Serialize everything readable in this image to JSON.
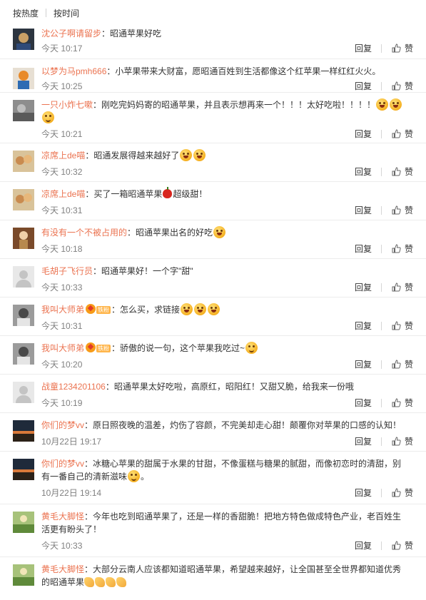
{
  "sort": {
    "hot_label": "按热度",
    "time_label": "按时间"
  },
  "actions": {
    "reply": "回复",
    "like": "赞"
  },
  "colors": {
    "username": "#eb7350",
    "meta": "#808080",
    "divider": "#ececec"
  },
  "comments": [
    {
      "user": "沈公子啊请留步",
      "text": "昭通苹果好吃",
      "time": "今天 10:17",
      "avatar": "dark-figure"
    },
    {
      "user": "以梦为马pmh666",
      "text": "小苹果带来大财富，愿昭通百姓到生活都像这个红苹果一样红红火火。",
      "time": "今天 10:25",
      "avatar": "orange-figure"
    },
    {
      "user": "一只小炸七嗽",
      "text": "刚吃完妈妈寄的昭通苹果，并且表示想再来一个！！！太好吃啦！！！！",
      "time": "今天 10:21",
      "avatar": "gray-photo"
    },
    {
      "user": "凉席上de喵",
      "text": "昭通发展得越来越好了",
      "time": "今天 10:32",
      "avatar": "cat-photo"
    },
    {
      "user": "凉席上de喵",
      "text": "买了一箱昭通苹果",
      "text2": "超级甜！",
      "time": "今天 10:31",
      "avatar": "cat-photo"
    },
    {
      "user": "有没有一个不被占用的",
      "text": "昭通苹果出名的好吃",
      "time": "今天 10:18",
      "avatar": "brown-figure"
    },
    {
      "user": "毛胡子飞行员",
      "text": "昭通苹果好！一个字\"甜\"",
      "time": "今天 10:33",
      "avatar": "default"
    },
    {
      "user": "我叫大师弟",
      "badge": "铁粉",
      "text": "怎么买，求链接",
      "time": "今天 10:31",
      "avatar": "bw-portrait"
    },
    {
      "user": "我叫大师弟",
      "badge": "铁粉",
      "text": "骄傲的说一句，这个苹果我吃过~",
      "time": "今天 10:20",
      "avatar": "bw-portrait"
    },
    {
      "user": "战童1234201106",
      "text": "昭通苹果太好吃啦，高原红，昭阳红！又甜又脆，给我来一份哦",
      "time": "今天 10:19",
      "avatar": "default"
    },
    {
      "user": "你们的梦vv",
      "text": "原日照夜晚的温差，灼伤了容颜，不完美却走心甜！颠覆你对苹果的口感的认知！",
      "time": "10月22日 19:17",
      "avatar": "sunset"
    },
    {
      "user": "你们的梦vv",
      "text": "冰糖心苹果的甜属于水果的甘甜，不像蛋糕与糖果的腻甜，而像初恋时的清甜，别有一番自己的清新滋味",
      "time": "10月22日 19:14",
      "avatar": "sunset"
    },
    {
      "user": "黄毛大脚怪",
      "text": "今年也吃到昭通苹果了，还是一样的香甜脆！把地方特色做成特色产业，老百姓生活更有盼头了！",
      "time": "今天 10:33",
      "avatar": "field"
    },
    {
      "user": "黄毛大脚怪",
      "text": "大部分云南人应该都知道昭通苹果，希望越来越好，让全国甚至全世界都知道优秀的昭通苹果",
      "time": "",
      "avatar": "field"
    }
  ]
}
